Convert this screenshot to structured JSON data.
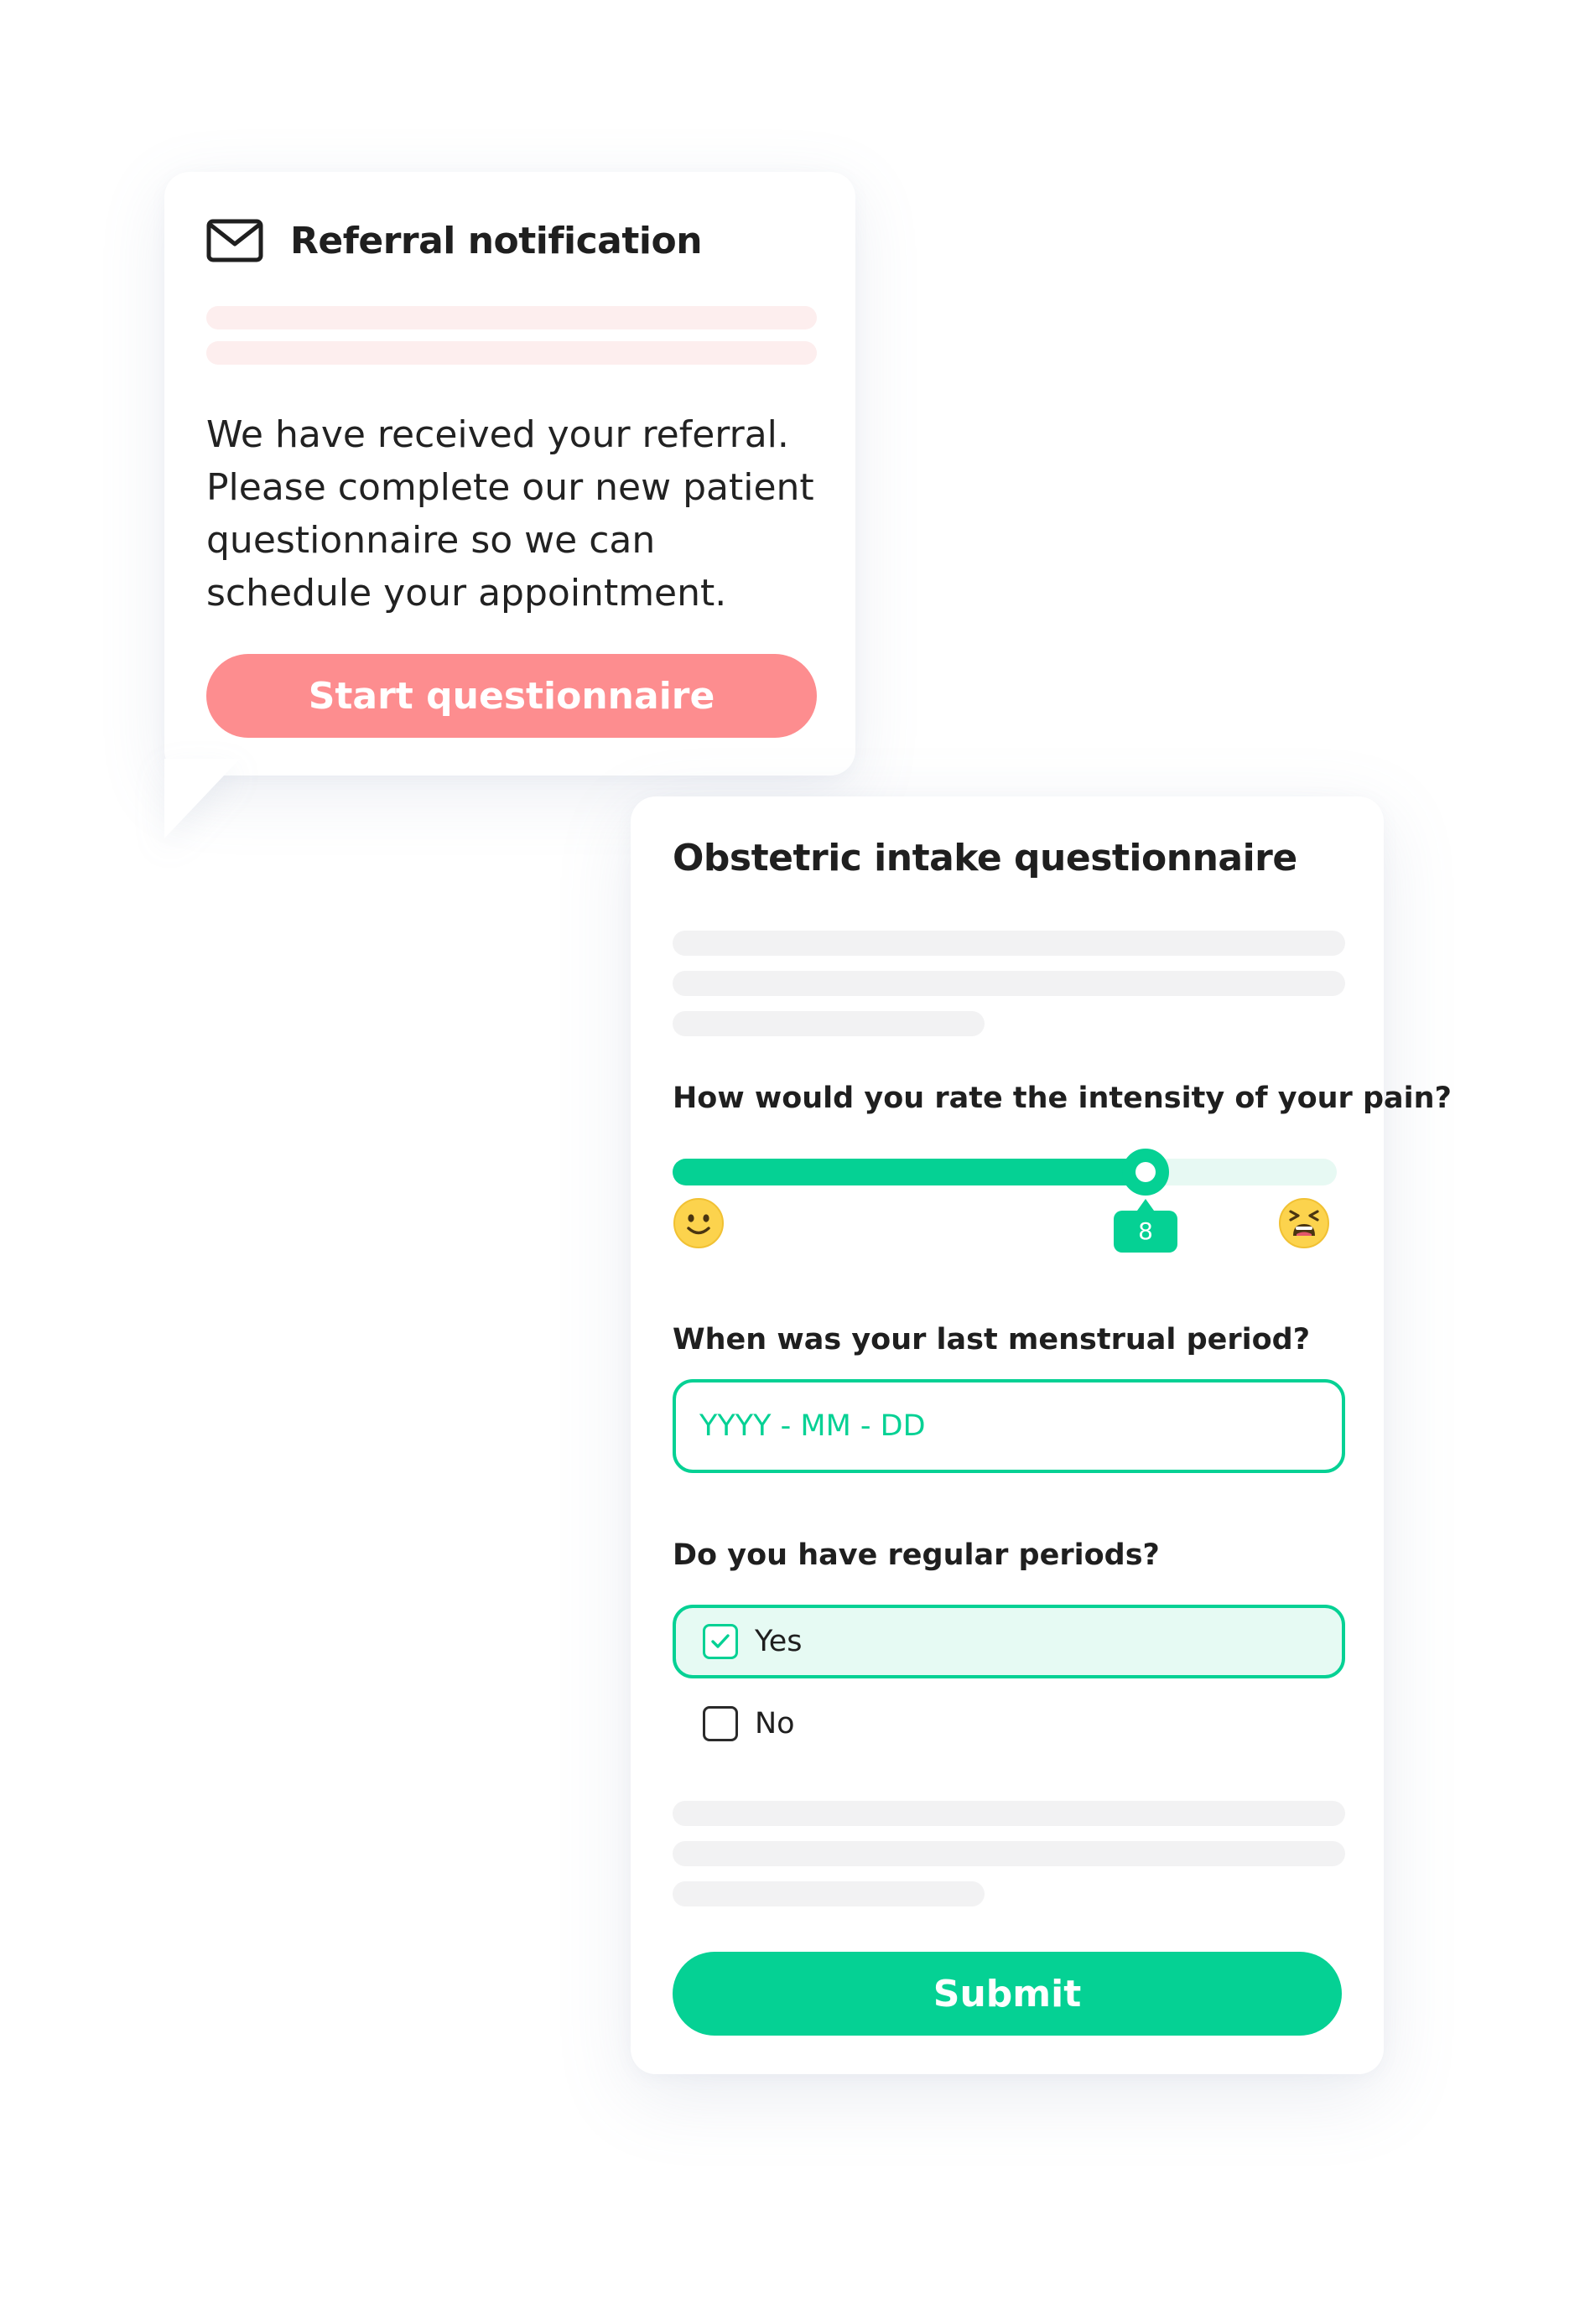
{
  "referral_card": {
    "icon": "envelope-icon",
    "title": "Referral notification",
    "message": "We have received your referral. Please complete our new patient questionnaire so we can schedule your appointment.",
    "start_button_label": "Start questionnaire"
  },
  "questionnaire": {
    "title": "Obstetric intake questionnaire",
    "pain_question": {
      "label": "How would you rate the intensity of your pain?",
      "min": 0,
      "max": 10,
      "value": "8",
      "min_icon": "smiling-face-icon",
      "max_icon": "tired-face-icon"
    },
    "period_question": {
      "label": "When was your last menstrual period?",
      "placeholder": "YYYY - MM - DD",
      "value": ""
    },
    "regular_question": {
      "label": "Do you have regular periods?",
      "options": [
        {
          "label": "Yes",
          "checked": true
        },
        {
          "label": "No",
          "checked": false
        }
      ]
    },
    "submit_label": "Submit"
  },
  "colors": {
    "accent": "#05d194",
    "accent_light": "#e6faf3",
    "start_button": "#fd8d8f",
    "skeleton_pink": "#fdeeee",
    "skeleton_gray": "#f2f2f3",
    "emoji_yellow": "#fcd34d"
  }
}
